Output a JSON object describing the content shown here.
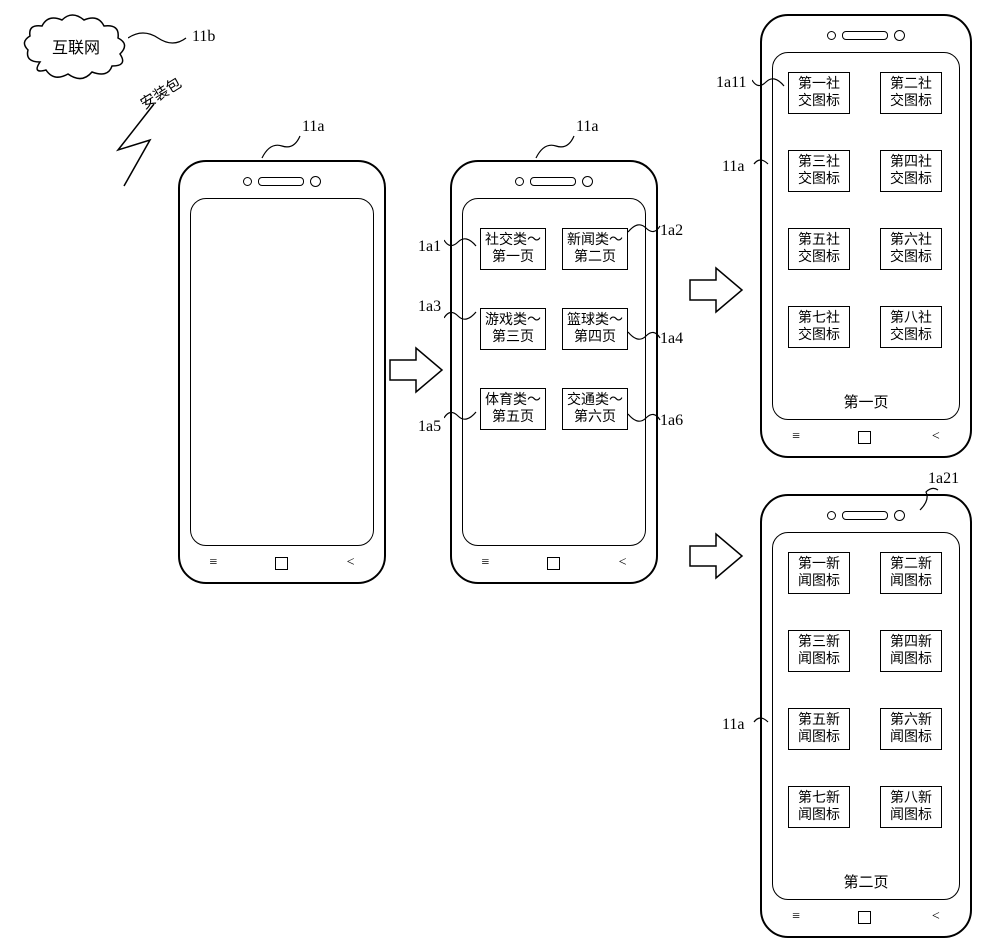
{
  "cloud_label": "互联网",
  "cloud_ref": "11b",
  "install_pkg_label": "安装包",
  "phone_ref": "11a",
  "phone2_categories": {
    "ref_1a1": "1a1",
    "ref_1a2": "1a2",
    "ref_1a3": "1a3",
    "ref_1a4": "1a4",
    "ref_1a5": "1a5",
    "ref_1a6": "1a6",
    "tiles": {
      "t1a1": "社交类～\n第一页",
      "t1a2": "新闻类～\n第二页",
      "t1a3": "游戏类～\n第三页",
      "t1a4": "篮球类～\n第四页",
      "t1a5": "体育类～\n第五页",
      "t1a6": "交通类～\n第六页"
    }
  },
  "phone3_social": {
    "ref_1a11": "1a11",
    "tiles": {
      "s1": "第一社\n交图标",
      "s2": "第二社\n交图标",
      "s3": "第三社\n交图标",
      "s4": "第四社\n交图标",
      "s5": "第五社\n交图标",
      "s6": "第六社\n交图标",
      "s7": "第七社\n交图标",
      "s8": "第八社\n交图标"
    },
    "page_label": "第一页"
  },
  "phone4_news": {
    "ref_1a21": "1a21",
    "tiles": {
      "n1": "第一新\n闻图标",
      "n2": "第二新\n闻图标",
      "n3": "第三新\n闻图标",
      "n4": "第四新\n闻图标",
      "n5": "第五新\n闻图标",
      "n6": "第六新\n闻图标",
      "n7": "第七新\n闻图标",
      "n8": "第八新\n闻图标"
    },
    "page_label": "第二页"
  }
}
